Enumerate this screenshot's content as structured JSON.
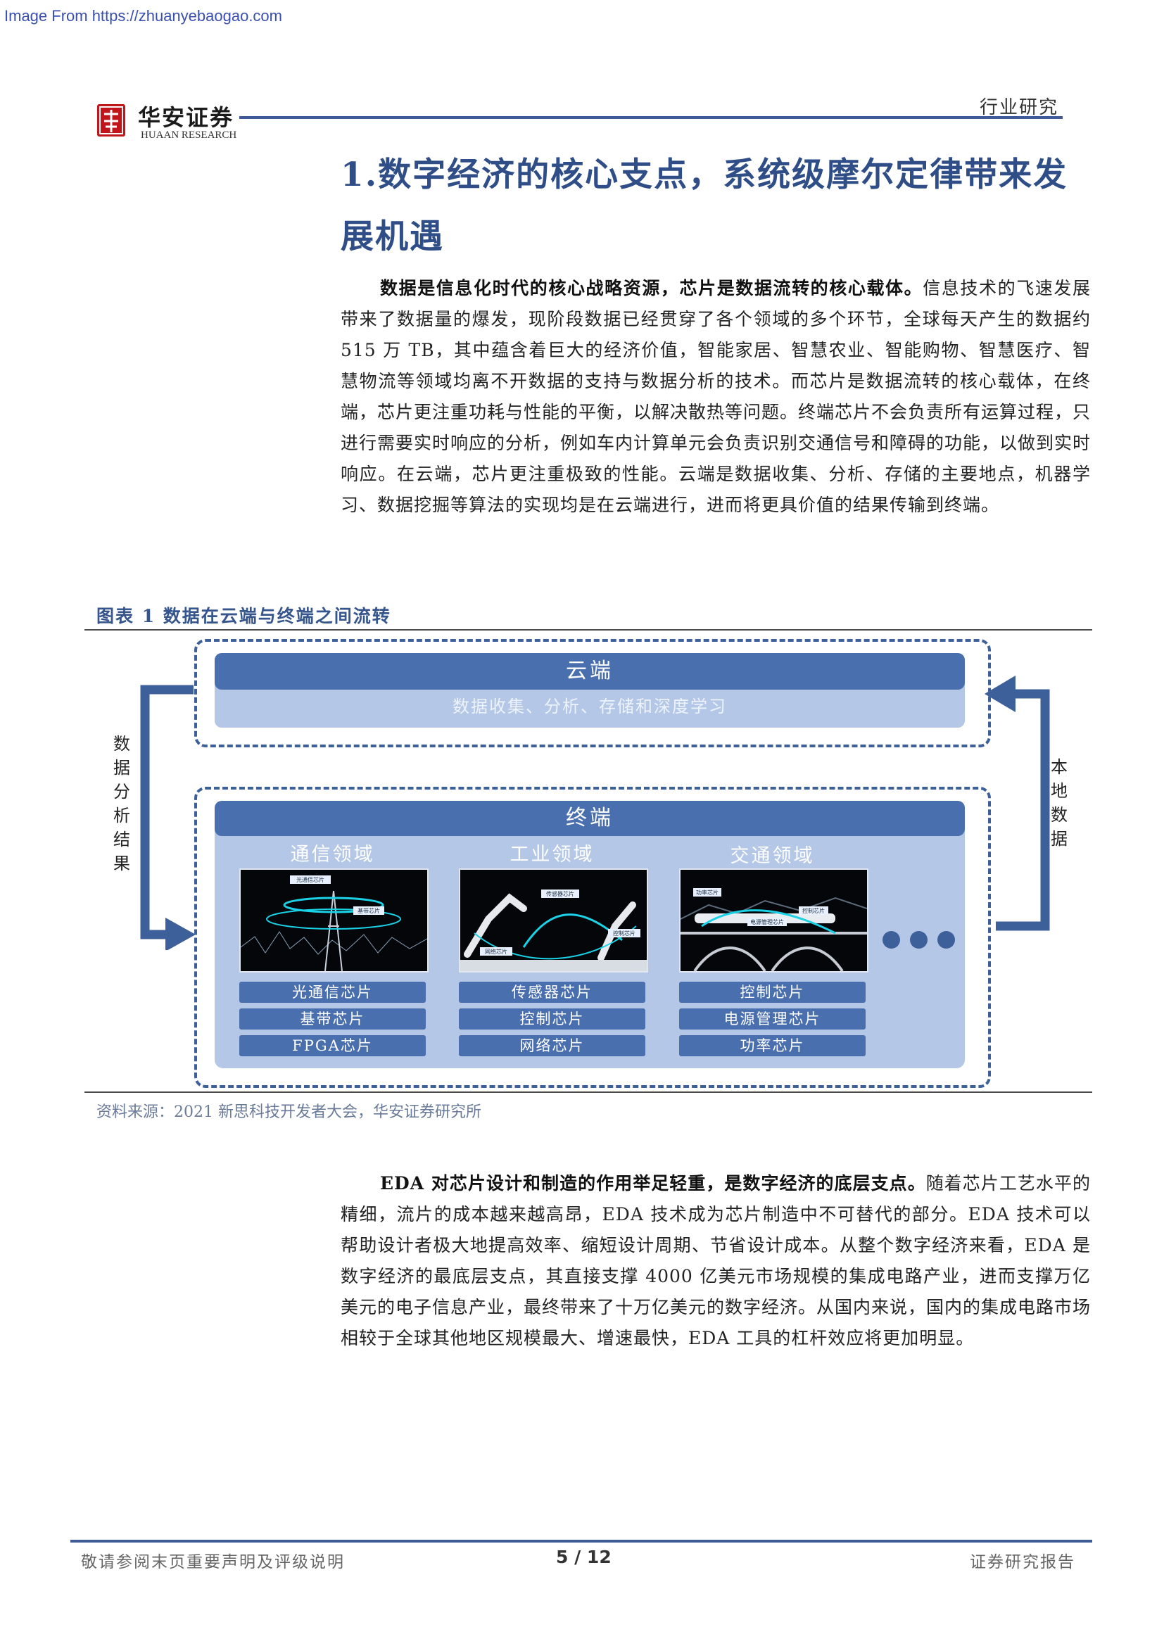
{
  "watermark": "Image From https://zhuanyebaogao.com",
  "header": {
    "logo_cn": "华安证券",
    "logo_en": "HUAAN RESEARCH",
    "section_tag": "行业研究"
  },
  "title": "1.数字经济的核心支点，系统级摩尔定律带来发展机遇",
  "para1": {
    "lead": "数据是信息化时代的核心战略资源，芯片是数据流转的核心载体。",
    "body": "信息技术的飞速发展带来了数据量的爆发，现阶段数据已经贯穿了各个领域的多个环节，全球每天产生的数据约 515 万 TB，其中蕴含着巨大的经济价值，智能家居、智慧农业、智能购物、智慧医疗、智慧物流等领域均离不开数据的支持与数据分析的技术。而芯片是数据流转的核心载体，在终端，芯片更注重功耗与性能的平衡，以解决散热等问题。终端芯片不会负责所有运算过程，只进行需要实时响应的分析，例如车内计算单元会负责识别交通信号和障碍的功能，以做到实时响应。在云端，芯片更注重极致的性能。云端是数据收集、分析、存储的主要地点，机器学习、数据挖掘等算法的实现均是在云端进行，进而将更具价值的结果传输到终端。"
  },
  "figure": {
    "title": "图表 1 数据在云端与终端之间流转",
    "cloud": {
      "title": "云端",
      "subtitle": "数据收集、分析、存储和深度学习"
    },
    "terminal": {
      "title": "终端"
    },
    "left_label": "数据分析结果",
    "right_label": "本地数据",
    "domains": [
      {
        "name": "通信领域",
        "photo_tags": [
          "光通信芯片",
          "基带芯片"
        ],
        "chips": [
          "光通信芯片",
          "基带芯片",
          "FPGA芯片"
        ]
      },
      {
        "name": "工业领域",
        "photo_tags": [
          "传感器芯片",
          "控制芯片",
          "网络芯片"
        ],
        "chips": [
          "传感器芯片",
          "控制芯片",
          "网络芯片"
        ]
      },
      {
        "name": "交通领域",
        "photo_tags": [
          "功率芯片",
          "控制芯片",
          "电源管理芯片"
        ],
        "chips": [
          "控制芯片",
          "电源管理芯片",
          "功率芯片"
        ]
      }
    ],
    "more_indicator": "more-dots",
    "source": "资料来源：2021 新思科技开发者大会，华安证券研究所"
  },
  "para2": {
    "lead": "EDA 对芯片设计和制造的作用举足轻重，是数字经济的底层支点。",
    "body": "随着芯片工艺水平的精细，流片的成本越来越高昂，EDA 技术成为芯片制造中不可替代的部分。EDA 技术可以帮助设计者极大地提高效率、缩短设计周期、节省设计成本。从整个数字经济来看，EDA 是数字经济的最底层支点，其直接支撑 4000 亿美元市场规模的集成电路产业，进而支撑万亿美元的电子信息产业，最终带来了十万亿美元的数字经济。从国内来说，国内的集成电路市场相较于全球其他地区规模最大、增速最快，EDA 工具的杠杆效应将更加明显。"
  },
  "footer": {
    "left": "敬请参阅末页重要声明及评级说明",
    "page": "5 / 12",
    "right": "证券研究报告"
  },
  "colors": {
    "brand_blue": "#3e5b97",
    "panel_light": "#b4c7e7",
    "panel_bar": "#4a6fae",
    "logo_red": "#c0161b"
  }
}
